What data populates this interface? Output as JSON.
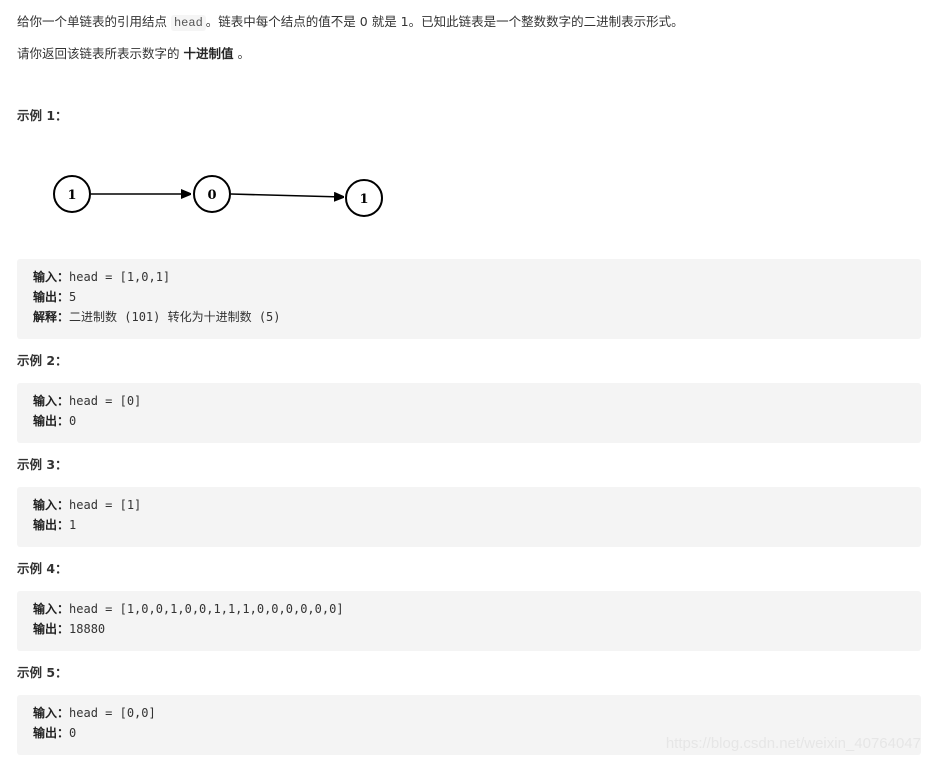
{
  "description": {
    "line1_before": "给你一个单链表的引用结点 ",
    "line1_code": "head",
    "line1_after": "。链表中每个结点的值不是 0 就是 1。已知此链表是一个整数数字的二进制表示形式。",
    "line2_before": "请你返回该链表所表示数字的 ",
    "line2_bold": "十进制值",
    "line2_after": " 。"
  },
  "diagram": {
    "nodes": [
      "1",
      "0",
      "1"
    ]
  },
  "examples": [
    {
      "title": "示例 1：",
      "lines": [
        {
          "label": "输入：",
          "value": "head = [1,0,1]"
        },
        {
          "label": "输出：",
          "value": "5"
        },
        {
          "label": "解释：",
          "value": "二进制数 (101) 转化为十进制数 (5)"
        }
      ]
    },
    {
      "title": "示例 2：",
      "lines": [
        {
          "label": "输入：",
          "value": "head = [0]"
        },
        {
          "label": "输出：",
          "value": "0"
        }
      ]
    },
    {
      "title": "示例 3：",
      "lines": [
        {
          "label": "输入：",
          "value": "head = [1]"
        },
        {
          "label": "输出：",
          "value": "1"
        }
      ]
    },
    {
      "title": "示例 4：",
      "lines": [
        {
          "label": "输入：",
          "value": "head = [1,0,0,1,0,0,1,1,1,0,0,0,0,0,0]"
        },
        {
          "label": "输出：",
          "value": "18880"
        }
      ]
    },
    {
      "title": "示例 5：",
      "lines": [
        {
          "label": "输入：",
          "value": "head = [0,0]"
        },
        {
          "label": "输出：",
          "value": "0"
        }
      ]
    }
  ],
  "watermark": "https://blog.csdn.net/weixin_40764047"
}
